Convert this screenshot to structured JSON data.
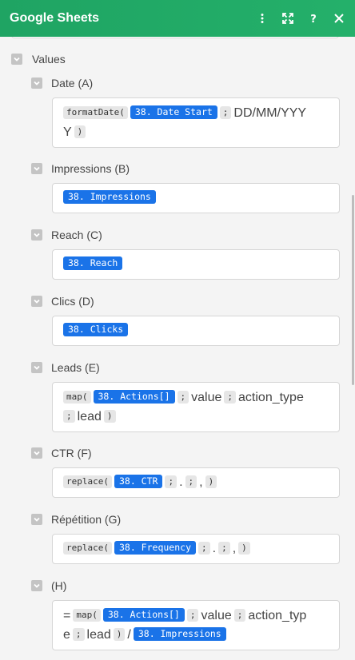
{
  "header": {
    "title": "Google Sheets"
  },
  "header_icons": [
    "more-vertical-icon",
    "expand-icon",
    "help-icon",
    "close-icon"
  ],
  "group": {
    "label": "Values"
  },
  "fields": [
    {
      "label": "Date (A)",
      "tokens": [
        {
          "t": "fn",
          "v": "formatDate("
        },
        {
          "t": "var",
          "v": "38. Date Start"
        },
        {
          "t": "sep",
          "v": ";"
        },
        {
          "t": "txt",
          "v": "DD/MM/YYY"
        },
        {
          "t": "br"
        },
        {
          "t": "txt",
          "v": "Y"
        },
        {
          "t": "sep",
          "v": ")"
        }
      ]
    },
    {
      "label": "Impressions (B)",
      "tokens": [
        {
          "t": "var",
          "v": "38. Impressions"
        }
      ]
    },
    {
      "label": "Reach (C)",
      "tokens": [
        {
          "t": "var",
          "v": "38. Reach"
        }
      ]
    },
    {
      "label": "Clics (D)",
      "tokens": [
        {
          "t": "var",
          "v": "38. Clicks"
        }
      ]
    },
    {
      "label": "Leads (E)",
      "tokens": [
        {
          "t": "fn",
          "v": "map("
        },
        {
          "t": "var",
          "v": "38. Actions[]"
        },
        {
          "t": "sep",
          "v": ";"
        },
        {
          "t": "txt",
          "v": "value"
        },
        {
          "t": "sep",
          "v": ";"
        },
        {
          "t": "txt",
          "v": "action_type"
        },
        {
          "t": "br"
        },
        {
          "t": "sep",
          "v": ";"
        },
        {
          "t": "txt",
          "v": "lead"
        },
        {
          "t": "sep",
          "v": ")"
        }
      ]
    },
    {
      "label": "CTR (F)",
      "tokens": [
        {
          "t": "fn",
          "v": "replace("
        },
        {
          "t": "var",
          "v": "38. CTR"
        },
        {
          "t": "sep",
          "v": ";"
        },
        {
          "t": "txt",
          "v": "."
        },
        {
          "t": "sep",
          "v": ";"
        },
        {
          "t": "txt",
          "v": ","
        },
        {
          "t": "sep",
          "v": ")"
        }
      ]
    },
    {
      "label": "Répétition (G)",
      "tokens": [
        {
          "t": "fn",
          "v": "replace("
        },
        {
          "t": "var",
          "v": "38. Frequency"
        },
        {
          "t": "sep",
          "v": ";"
        },
        {
          "t": "txt",
          "v": "."
        },
        {
          "t": "sep",
          "v": ";"
        },
        {
          "t": "txt",
          "v": ","
        },
        {
          "t": "sep",
          "v": ")"
        }
      ]
    },
    {
      "label": "(H)",
      "tokens": [
        {
          "t": "txt",
          "v": "="
        },
        {
          "t": "fn",
          "v": "map("
        },
        {
          "t": "var",
          "v": "38. Actions[]"
        },
        {
          "t": "sep",
          "v": ";"
        },
        {
          "t": "txt",
          "v": "value"
        },
        {
          "t": "sep",
          "v": ";"
        },
        {
          "t": "txt",
          "v": "action_typ"
        },
        {
          "t": "br"
        },
        {
          "t": "txt",
          "v": "e"
        },
        {
          "t": "sep",
          "v": ";"
        },
        {
          "t": "txt",
          "v": "lead"
        },
        {
          "t": "sep",
          "v": ")"
        },
        {
          "t": "txt",
          "v": "/"
        },
        {
          "t": "var",
          "v": "38. Impressions"
        }
      ]
    }
  ],
  "colors": {
    "header": "#22aa66",
    "variable_pill": "#1a73e8",
    "function_pill": "#e6e6e6"
  }
}
